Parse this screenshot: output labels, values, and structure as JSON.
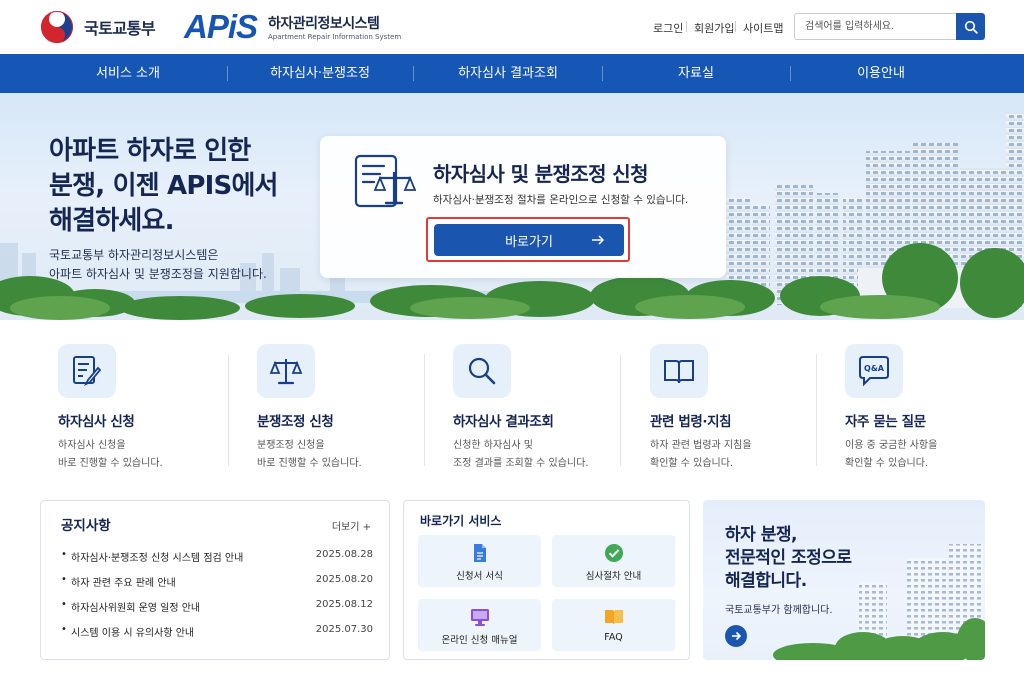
{
  "header": {
    "gov_name": "국토교통부",
    "logo_wordmark": "APiS",
    "system_title": "하자관리정보시스템",
    "system_subtitle": "Apartment Repair Information System",
    "util_links": [
      "로그인",
      "회원가입",
      "사이트맵"
    ],
    "search_placeholder": "검색어를 입력하세요.",
    "brand_color": "#1656b4"
  },
  "nav": {
    "items": [
      "서비스 소개",
      "하자심사·분쟁조정",
      "하자심사 결과조회",
      "자료실",
      "이용안내"
    ]
  },
  "hero": {
    "title_lines": [
      "아파트 하자로 인한",
      "분쟁, 이젠 APIS에서",
      "해결하세요."
    ],
    "desc_lines": [
      "국토교통부 하자관리정보시스템은",
      "아파트 하자심사 및 분쟁조정을 지원합니다."
    ],
    "card": {
      "icon": "document-scale-icon",
      "title": "하자심사 및 분쟁조정 신청",
      "desc": "하자심사·분쟁조정 절차를 온라인으로 신청할 수 있습니다.",
      "button_label": "바로가기",
      "highlight_color": "#e03a3a"
    }
  },
  "services": [
    {
      "icon": "document-edit-icon",
      "title": "하자심사 신청",
      "desc": [
        "하자심사 신청을",
        "바로 진행할 수 있습니다."
      ]
    },
    {
      "icon": "scale-icon",
      "title": "분쟁조정 신청",
      "desc": [
        "분쟁조정 신청을",
        "바로 진행할 수 있습니다."
      ]
    },
    {
      "icon": "magnifier-icon",
      "title": "하자심사 결과조회",
      "desc": [
        "신청한 하자심사 및",
        "조정 결과를 조회할 수 있습니다."
      ]
    },
    {
      "icon": "book-icon",
      "title": "관련 법령·지침",
      "desc": [
        "하자 관련 법령과 지침을",
        "확인할 수 있습니다."
      ]
    },
    {
      "icon": "qa-bubble-icon",
      "title": "자주 묻는 질문",
      "desc": [
        "이용 중 궁금한 사항을",
        "확인할 수 있습니다."
      ]
    }
  ],
  "notice": {
    "title": "공지사항",
    "more_label": "더보기 +",
    "items": [
      {
        "text": "하자심사·분쟁조정 신청 시스템 점검 안내",
        "date": "2025.08.28"
      },
      {
        "text": "하자 관련 주요 판례 안내",
        "date": "2025.08.20"
      },
      {
        "text": "하자심사위원회 운영 일정 안내",
        "date": "2025.08.12"
      },
      {
        "text": "시스템 이용 시 유의사항 안내",
        "date": "2025.07.30"
      }
    ]
  },
  "quick": {
    "title": "바로가기 서비스",
    "items": [
      {
        "icon": "document-icon",
        "label": "신청서 서식"
      },
      {
        "icon": "check-circle-icon",
        "label": "심사절차 안내"
      },
      {
        "icon": "monitor-icon",
        "label": "온라인 신청 매뉴얼"
      },
      {
        "icon": "open-book-icon",
        "label": "FAQ"
      }
    ]
  },
  "banner": {
    "title_lines": [
      "하자 분쟁,",
      "전문적인 조정으로",
      "해결합니다."
    ],
    "sub": "국토교통부가 함께합니다."
  }
}
